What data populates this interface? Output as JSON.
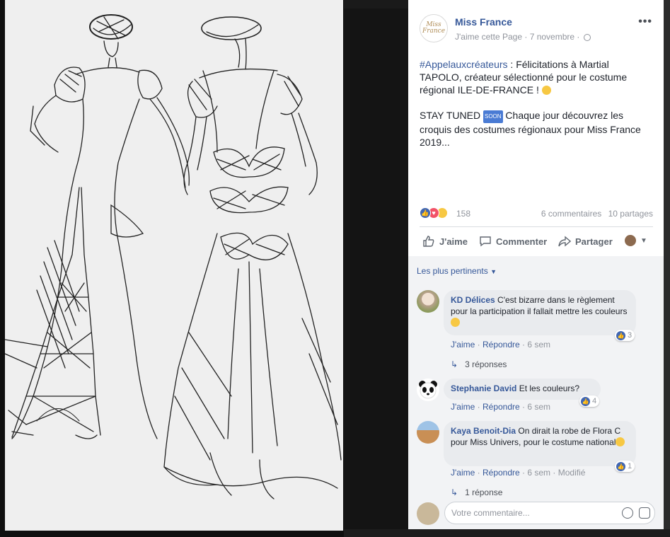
{
  "post": {
    "page_name": "Miss France",
    "logo_text": "Miss France",
    "like_page": "J'aime cette Page",
    "date": "7 novembre",
    "more": "•••",
    "hashtag": "#Appelauxcréateurs",
    "text1": " : Félicitations à Martial TAPOLO, créateur sélectionné pour le costume régional ILE-DE-FRANCE ! ",
    "stay_prefix": "STAY TUNED ",
    "soon": "SOON",
    "text2": " Chaque jour découvrez les croquis des costumes régionaux pour Miss France 2019..."
  },
  "reactions": {
    "count": "158",
    "comments": "6 commentaires",
    "shares": "10 partages"
  },
  "actions": {
    "like": "J'aime",
    "comment": "Commenter",
    "share": "Partager"
  },
  "comments_section": {
    "sort_label": "Les plus pertinents",
    "comments": [
      {
        "name": "KD Délices",
        "text": "C'est bizarre dans le règlement pour la participation il fallait mettre les couleurs",
        "likes": "3",
        "like": "J'aime",
        "reply": "Répondre",
        "time": "6 sem",
        "replies": "3 réponses"
      },
      {
        "name": "Stephanie David",
        "text": "Et les couleurs?",
        "likes": "4",
        "like": "J'aime",
        "reply": "Répondre",
        "time": "6 sem"
      },
      {
        "name": "Kaya Benoit-Dia",
        "text": "On dirait la robe de Flora C pour Miss Univers, pour le costume national",
        "likes": "1",
        "like": "J'aime",
        "reply": "Répondre",
        "time": "6 sem",
        "modified": "Modifié",
        "replies": "1 réponse"
      }
    ],
    "placeholder": "Votre commentaire..."
  }
}
